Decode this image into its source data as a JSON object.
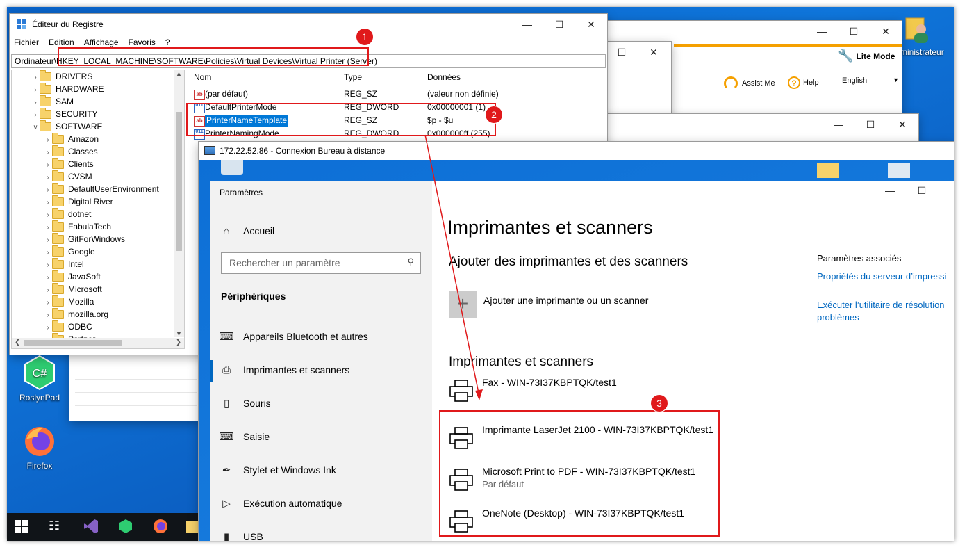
{
  "regedit": {
    "title": "Éditeur du Registre",
    "menu": [
      "Fichier",
      "Edition",
      "Affichage",
      "Favoris",
      "?"
    ],
    "address_prefix": "Ordinateur\\",
    "address_path": "HKEY_LOCAL_MACHINE\\SOFTWARE\\Policies\\Virtual Devices\\Virtual Printer (Server)",
    "tree": [
      "DRIVERS",
      "HARDWARE",
      "SAM",
      "SECURITY",
      "SOFTWARE",
      "Amazon",
      "Classes",
      "Clients",
      "CVSM",
      "DefaultUserEnvironment",
      "Digital River",
      "dotnet",
      "FabulaTech",
      "GitForWindows",
      "Google",
      "Intel",
      "JavaSoft",
      "Microsoft",
      "Mozilla",
      "mozilla.org",
      "ODBC",
      "Partner"
    ],
    "columns": {
      "name": "Nom",
      "type": "Type",
      "data": "Données"
    },
    "values": [
      {
        "name": "(par défaut)",
        "type": "REG_SZ",
        "data": "(valeur non définie)",
        "icon": "ab"
      },
      {
        "name": "DefaultPrinterMode",
        "type": "REG_DWORD",
        "data": "0x00000001 (1)",
        "icon": "num"
      },
      {
        "name": "PrinterNameTemplate",
        "type": "REG_SZ",
        "data": "$p - $u",
        "icon": "ab"
      },
      {
        "name": "PrinterNamingMode",
        "type": "REG_DWORD",
        "data": "0x000000ff (255)",
        "icon": "num"
      }
    ]
  },
  "badges": [
    "1",
    "2",
    "3"
  ],
  "orange_app": {
    "lite_mode": "Lite Mode",
    "assist": "Assist Me",
    "help": "Help",
    "language": "English"
  },
  "rdp": {
    "title": "172.22.52.86 - Connexion Bureau à distance"
  },
  "settings": {
    "app_title": "Paramètres",
    "home": "Accueil",
    "search_placeholder": "Rechercher un paramètre",
    "section": "Périphériques",
    "nav": [
      {
        "label": "Appareils Bluetooth et autres",
        "icon": "keyboard-icon"
      },
      {
        "label": "Imprimantes et scanners",
        "icon": "printer-icon"
      },
      {
        "label": "Souris",
        "icon": "mouse-icon"
      },
      {
        "label": "Saisie",
        "icon": "keyboard-icon"
      },
      {
        "label": "Stylet et Windows Ink",
        "icon": "pen-icon"
      },
      {
        "label": "Exécution automatique",
        "icon": "autoplay-icon"
      },
      {
        "label": "USB",
        "icon": "usb-icon"
      }
    ],
    "page_title": "Imprimantes et scanners",
    "add_heading": "Ajouter des imprimantes et des scanners",
    "add_button": "Ajouter une imprimante ou un scanner",
    "list_heading": "Imprimantes et scanners",
    "printers": [
      {
        "name": "Fax - WIN-73I37KBPTQK/test1",
        "sub": ""
      },
      {
        "name": "Imprimante LaserJet 2100 - WIN-73I37KBPTQK/test1",
        "sub": ""
      },
      {
        "name": "Microsoft Print to PDF - WIN-73I37KBPTQK/test1",
        "sub": "Par défaut"
      },
      {
        "name": "OneNote (Desktop) - WIN-73I37KBPTQK/test1",
        "sub": ""
      }
    ],
    "related_heading": "Paramètres associés",
    "related_link1": "Propriétés du serveur d’impressi",
    "related_link2": "Exécuter l’utilitaire de résolution problèmes"
  },
  "desktop": {
    "icons": [
      "RoslynPad",
      "Firefox"
    ],
    "user_label": "ministrateur",
    "partial_m": "M"
  },
  "colors": {
    "accent": "#0067c0",
    "annotation": "#e0191b",
    "orange": "#f5a000"
  }
}
